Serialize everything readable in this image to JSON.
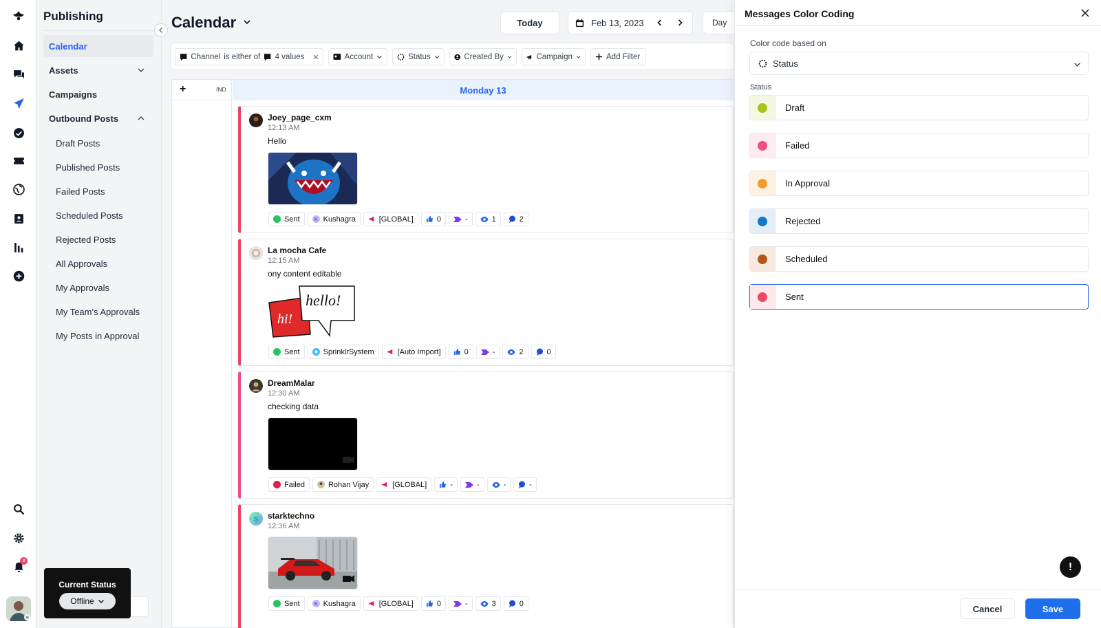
{
  "app": {
    "section_title": "Publishing"
  },
  "sidebar": {
    "items": [
      {
        "label": "Calendar"
      },
      {
        "label": "Assets"
      },
      {
        "label": "Campaigns"
      },
      {
        "label": "Outbound Posts"
      }
    ],
    "sub_items": [
      {
        "label": "Draft Posts"
      },
      {
        "label": "Published Posts"
      },
      {
        "label": "Failed Posts"
      },
      {
        "label": "Scheduled Posts"
      },
      {
        "label": "Rejected Posts"
      },
      {
        "label": "All Approvals"
      },
      {
        "label": "My Approvals"
      },
      {
        "label": "My Team's Approvals"
      },
      {
        "label": "My Posts in Approval"
      }
    ],
    "current_status": {
      "label": "Current Status",
      "value": "Offline"
    },
    "notifications_count": "9"
  },
  "header": {
    "title": "Calendar",
    "today_label": "Today",
    "date": "Feb 13, 2023",
    "view_label": "Day"
  },
  "filters": {
    "channel": {
      "label": "Channel",
      "operator": "is either of",
      "value": "4 values"
    },
    "account": "Account",
    "status": "Status",
    "created_by": "Created By",
    "campaign": "Campaign",
    "add_filter": "Add Filter"
  },
  "calendar": {
    "add_label": "+",
    "column_label": "IND",
    "day_header": "Monday 13",
    "posts": [
      {
        "author": "Joey_page_cxm",
        "time": "12:13 AM",
        "text": "Hello",
        "status": "Sent",
        "user": "Kushagra",
        "campaign": "[GLOBAL]",
        "likes": "0",
        "shares": "-",
        "views": "1",
        "comments": "2"
      },
      {
        "author": "La mocha Cafe",
        "time": "12:15 AM",
        "text": "ony content editable",
        "status": "Sent",
        "user": "SprinklrSystem",
        "campaign": "[Auto Import]",
        "likes": "0",
        "shares": "-",
        "views": "2",
        "comments": "0"
      },
      {
        "author": "DreamMalar",
        "time": "12:30 AM",
        "text": "checking data",
        "status": "Failed",
        "user": "Rohan Vijay",
        "campaign": "[GLOBAL]",
        "likes": "-",
        "shares": "-",
        "views": "-",
        "comments": "-"
      },
      {
        "author": "starktechno",
        "time": "12:36 AM",
        "text": "",
        "status": "Sent",
        "user": "Kushagra",
        "campaign": "[GLOBAL]",
        "likes": "0",
        "shares": "-",
        "views": "3",
        "comments": "0"
      }
    ]
  },
  "panel": {
    "title": "Messages Color Coding",
    "color_code_label": "Color code based on",
    "color_code_value": "Status",
    "status_label": "Status",
    "statuses": [
      {
        "name": "Draft",
        "color": "#a8c41a",
        "swatch_bg": "#f4f8e3"
      },
      {
        "name": "Failed",
        "color": "#ec4e87",
        "swatch_bg": "#fdebf1"
      },
      {
        "name": "In Approval",
        "color": "#f39a2b",
        "swatch_bg": "#fdf1e1"
      },
      {
        "name": "Rejected",
        "color": "#1679c7",
        "swatch_bg": "#e3eef8"
      },
      {
        "name": "Scheduled",
        "color": "#b4561c",
        "swatch_bg": "#f6e9e0"
      },
      {
        "name": "Sent",
        "color": "#ef4565",
        "swatch_bg": "#fde8ec"
      }
    ],
    "selected_status": "Sent",
    "cancel_label": "Cancel",
    "save_label": "Save",
    "help_label": "!"
  }
}
